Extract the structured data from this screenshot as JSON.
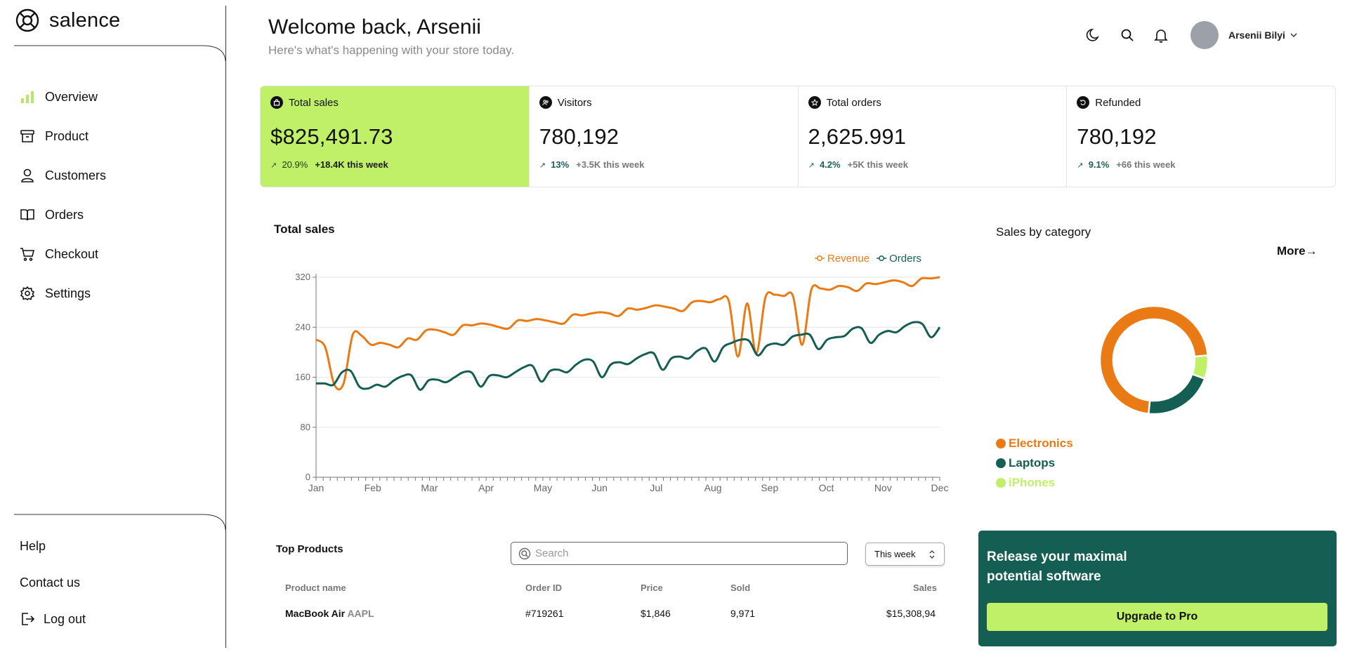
{
  "brand": {
    "name": "salence"
  },
  "sidebar": {
    "items": [
      {
        "label": "Overview",
        "icon": "bar-chart-icon",
        "active": true
      },
      {
        "label": "Product",
        "icon": "archive-icon"
      },
      {
        "label": "Customers",
        "icon": "user-icon"
      },
      {
        "label": "Orders",
        "icon": "book-open-icon"
      },
      {
        "label": "Checkout",
        "icon": "cart-icon"
      },
      {
        "label": "Settings",
        "icon": "gear-icon"
      }
    ],
    "bottom": [
      {
        "label": "Help"
      },
      {
        "label": "Contact us"
      },
      {
        "label": "Log out",
        "icon": "logout-icon"
      }
    ]
  },
  "header": {
    "welcome": "Welcome back, Arsenii",
    "subtitle": "Here's what's happening with your store today.",
    "user_name": "Arsenii Bilyi"
  },
  "stats": [
    {
      "label": "Total sales",
      "value": "$825,491.73",
      "pct": "20.9%",
      "week": "+18.4K this week",
      "icon": "bag-icon"
    },
    {
      "label": "Visitors",
      "value": "780,192",
      "pct": "13%",
      "week": "+3.5K this week",
      "icon": "users-icon"
    },
    {
      "label": "Total orders",
      "value": "2,625.991",
      "pct": "4.2%",
      "week": "+5K this week",
      "icon": "star-icon"
    },
    {
      "label": "Refunded",
      "value": "780,192",
      "pct": "9.1%",
      "week": "+66 this week",
      "icon": "undo-icon"
    }
  ],
  "chart_data": {
    "type": "line",
    "title": "Total sales",
    "x": [
      "Jan",
      "Feb",
      "Mar",
      "Apr",
      "May",
      "Jun",
      "Jul",
      "Aug",
      "Sep",
      "Oct",
      "Nov",
      "Dec"
    ],
    "yticks": [
      0,
      80,
      160,
      240,
      320
    ],
    "ylim": [
      0,
      320
    ],
    "legend_position": "top-right",
    "series": [
      {
        "name": "Revenue",
        "color": "#ea7a14",
        "values": [
          220,
          208,
          148,
          150,
          228,
          226,
          212,
          215,
          212,
          208,
          222,
          220,
          235,
          236,
          232,
          228,
          243,
          243,
          246,
          244,
          240,
          238,
          251,
          250,
          253,
          251,
          248,
          246,
          260,
          259,
          262,
          264,
          262,
          258,
          270,
          268,
          271,
          275,
          273,
          270,
          266,
          280,
          282,
          280,
          285,
          282,
          193,
          278,
          198,
          288,
          292,
          290,
          290,
          212,
          300,
          302,
          300,
          306,
          304,
          298,
          310,
          309,
          312,
          315,
          312,
          306,
          318,
          318,
          320
        ]
      },
      {
        "name": "Orders",
        "color": "#155e53",
        "values": [
          150,
          150,
          148,
          168,
          170,
          145,
          142,
          148,
          145,
          155,
          162,
          163,
          140,
          155,
          156,
          152,
          160,
          168,
          167,
          145,
          162,
          163,
          160,
          168,
          176,
          178,
          153,
          170,
          172,
          168,
          180,
          188,
          185,
          160,
          180,
          184,
          181,
          190,
          197,
          198,
          172,
          190,
          193,
          190,
          202,
          206,
          185,
          208,
          215,
          220,
          218,
          195,
          210,
          214,
          212,
          225,
          228,
          228,
          205,
          220,
          224,
          226,
          238,
          238,
          215,
          228,
          234,
          232,
          242,
          248,
          245,
          224,
          240
        ]
      }
    ]
  },
  "category": {
    "title": "Sales by category",
    "more": "More→",
    "slices": [
      {
        "name": "Electronics",
        "value": 72,
        "color": "#ea7a14"
      },
      {
        "name": "Laptops",
        "value": 21,
        "color": "#155e53"
      },
      {
        "name": "iPhones",
        "value": 7,
        "color": "#c0f068"
      }
    ]
  },
  "products": {
    "title": "Top Products",
    "search_placeholder": "Search",
    "period": "This week",
    "columns": [
      "Product name",
      "Order ID",
      "Price",
      "Sold",
      "Sales"
    ],
    "rows": [
      {
        "name": "MacBook Air",
        "ticker": "AAPL",
        "order_id": "#719261",
        "price": "$1,846",
        "sold": "9,971",
        "sales": "$15,308,94"
      }
    ]
  },
  "promo": {
    "text": "Release your maximal potential software",
    "button": "Upgrade to Pro"
  }
}
